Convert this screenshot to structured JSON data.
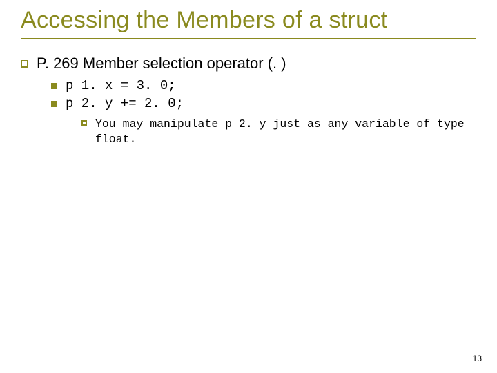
{
  "title": "Accessing the Members of a struct",
  "bullets": {
    "l1": "P. 269 Member selection operator (. )",
    "l2a": "p 1. x = 3. 0;",
    "l2b": "p 2. y += 2. 0;",
    "l3": "You may manipulate p 2. y just as any variable of type float."
  },
  "page": "13"
}
